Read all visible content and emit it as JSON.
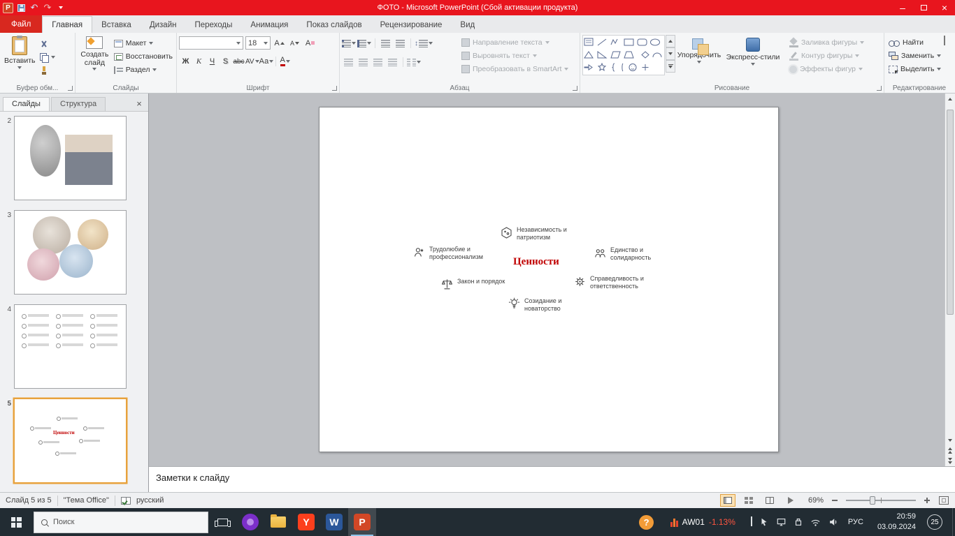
{
  "window": {
    "title": "ФОТО - Microsoft PowerPoint (Сбой активации продукта)",
    "titlebar_color": "#e8151e"
  },
  "icons": {
    "ppt_glyph": "P",
    "undo": "↶",
    "redo": "↷",
    "minimize": "–",
    "close": "×",
    "line_spacing": "↕",
    "help_glyph": "?",
    "yandex_glyph": "Y",
    "word_glyph": "W",
    "powerpoint_glyph": "P"
  },
  "tabs": {
    "file": "Файл",
    "items": [
      "Главная",
      "Вставка",
      "Дизайн",
      "Переходы",
      "Анимация",
      "Показ слайдов",
      "Рецензирование",
      "Вид"
    ]
  },
  "ribbon": {
    "clipboard": {
      "paste": "Вставить",
      "label": "Буфер обм..."
    },
    "slides": {
      "new_slide": "Создать слайд",
      "layout": "Макет",
      "reset": "Восстановить",
      "section": "Раздел",
      "label": "Слайды"
    },
    "font": {
      "family": "",
      "size": "18",
      "grow": "А",
      "shrink": "А",
      "clear": "А",
      "bold": "Ж",
      "italic": "К",
      "underline": "Ч",
      "shadow": "S",
      "strikethrough": "abc",
      "spacing": "AV",
      "case": "Аа",
      "color": "А",
      "label": "Шрифт"
    },
    "paragraph": {
      "text_direction": "Направление текста",
      "align_text": "Выровнять текст",
      "smartart": "Преобразовать в SmartArt",
      "label": "Абзац"
    },
    "drawing": {
      "arrange": "Упорядочить",
      "quick_styles": "Экспресс-стили",
      "shape_fill": "Заливка фигуры",
      "shape_outline": "Контур фигуры",
      "shape_effects": "Эффекты фигур",
      "label": "Рисование"
    },
    "editing": {
      "find": "Найти",
      "replace": "Заменить",
      "select": "Выделить",
      "label": "Редактирование"
    }
  },
  "slide_panel": {
    "tab_slides": "Слайды",
    "tab_outline": "Структура",
    "thumbnails": [
      {
        "number": "2"
      },
      {
        "number": "3"
      },
      {
        "number": "4"
      },
      {
        "number": "5"
      }
    ]
  },
  "slide": {
    "title": "Ценности",
    "title_color": "#c00000",
    "values": [
      {
        "label": "Независимость и патриотизм"
      },
      {
        "label": "Трудолюбие и профессионализм"
      },
      {
        "label": "Единство и солидарность"
      },
      {
        "label": "Закон и порядок"
      },
      {
        "label": "Справедливость и ответственность"
      },
      {
        "label": "Созидание и новаторство"
      }
    ]
  },
  "notes": {
    "placeholder": "Заметки к слайду"
  },
  "status_bar": {
    "slide_info": "Слайд 5 из 5",
    "theme": "\"Тема Office\"",
    "language": "русский",
    "zoom": "69%"
  },
  "taskbar": {
    "search": "Поиск",
    "ticker": "AW01",
    "ticker_change": "-1.13%",
    "language": "РУС",
    "time": "20:59",
    "date": "03.09.2024",
    "notification_count": "25"
  }
}
